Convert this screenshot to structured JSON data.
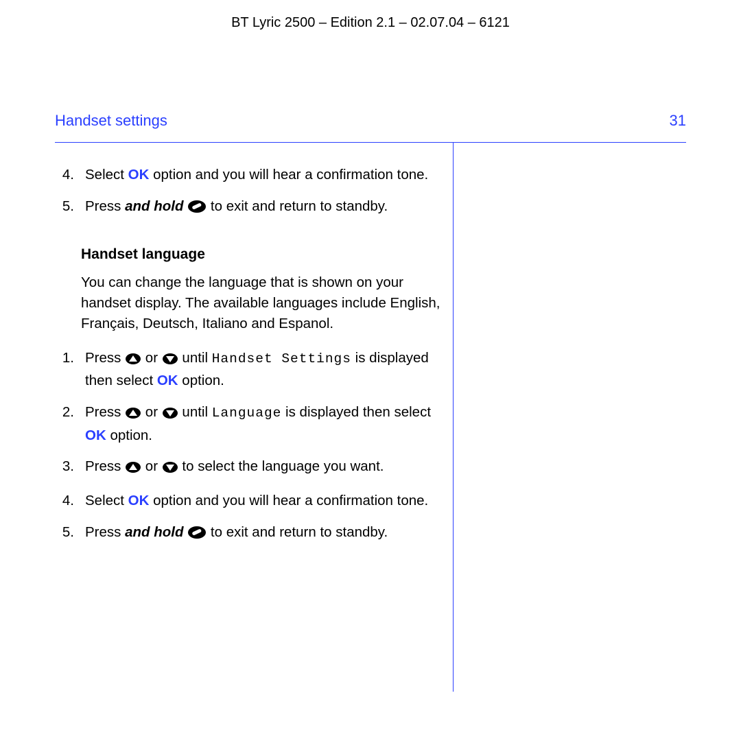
{
  "header": "BT Lyric 2500 – Edition 2.1 – 02.07.04 – 6121",
  "section_title": "Handset settings",
  "page_number": "31",
  "top_steps": {
    "s4": {
      "num": "4.",
      "a": "Select ",
      "ok": "OK",
      "b": " option and you will hear a confirmation tone."
    },
    "s5": {
      "num": "5.",
      "a": "Press ",
      "em": "and hold",
      "b": " to exit and return to standby."
    }
  },
  "subheading": "Handset language",
  "intro": "You can change the language that is shown on your handset display. The available languages include English, Français, Deutsch, Italiano and Espanol.",
  "lang_steps": {
    "s1": {
      "num": "1.",
      "a": "Press ",
      "or": " or ",
      "b": " until ",
      "menu": "Handset Settings",
      "c": " is displayed then select ",
      "ok": "OK",
      "d": " option."
    },
    "s2": {
      "num": "2.",
      "a": "Press ",
      "or": " or ",
      "b": " until ",
      "menu": "Language",
      "c": " is displayed then select ",
      "ok": "OK",
      "d": " option."
    },
    "s3": {
      "num": "3.",
      "a": "Press ",
      "or": " or ",
      "b": " to select the language you want."
    },
    "s4": {
      "num": "4.",
      "a": "Select ",
      "ok": "OK",
      "b": " option and you will hear a confirmation tone."
    },
    "s5": {
      "num": "5.",
      "a": "Press ",
      "em": "and hold",
      "b": " to exit and return to standby."
    }
  }
}
